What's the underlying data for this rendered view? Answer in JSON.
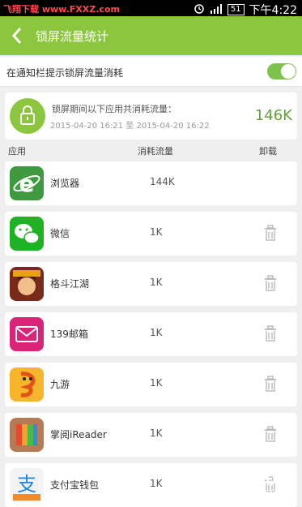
{
  "status_bar": {
    "watermark": "飞翔下载 www.FXXZ.com",
    "battery": "51",
    "time": "下午4:22"
  },
  "app_bar": {
    "title": "锁屏流量统计"
  },
  "notify_setting": {
    "label": "在通知栏提示锁屏流量消耗",
    "enabled": true
  },
  "summary": {
    "text": "锁屏期间以下应用共消耗流量：",
    "period": "2015-04-20 16:21 至 2015-04-20 16:22",
    "total": "146K"
  },
  "columns": {
    "app": "应用",
    "flow": "消耗流量",
    "uninstall": "卸载"
  },
  "apps": [
    {
      "name": "浏览器",
      "flow": "144K",
      "icon": "ie-browser-icon",
      "uninstall": false
    },
    {
      "name": "微信",
      "flow": "1K",
      "icon": "wechat-icon",
      "uninstall": true
    },
    {
      "name": "格斗江湖",
      "flow": "1K",
      "icon": "game-character-icon",
      "uninstall": true
    },
    {
      "name": "139邮箱",
      "flow": "1K",
      "icon": "mail-139-icon",
      "uninstall": true
    },
    {
      "name": "九游",
      "flow": "1K",
      "icon": "jiuyou-icon",
      "uninstall": true
    },
    {
      "name": "掌阅iReader",
      "flow": "1K",
      "icon": "ireader-icon",
      "uninstall": true
    },
    {
      "name": "支付宝钱包",
      "flow": "1K",
      "icon": "alipay-icon",
      "uninstall": true
    }
  ],
  "watermark": {
    "brand": "飞翔下载",
    "url": "WWW.FXXZ.COM"
  },
  "colors": {
    "accent": "#8cc63f",
    "value": "#61a23a"
  }
}
